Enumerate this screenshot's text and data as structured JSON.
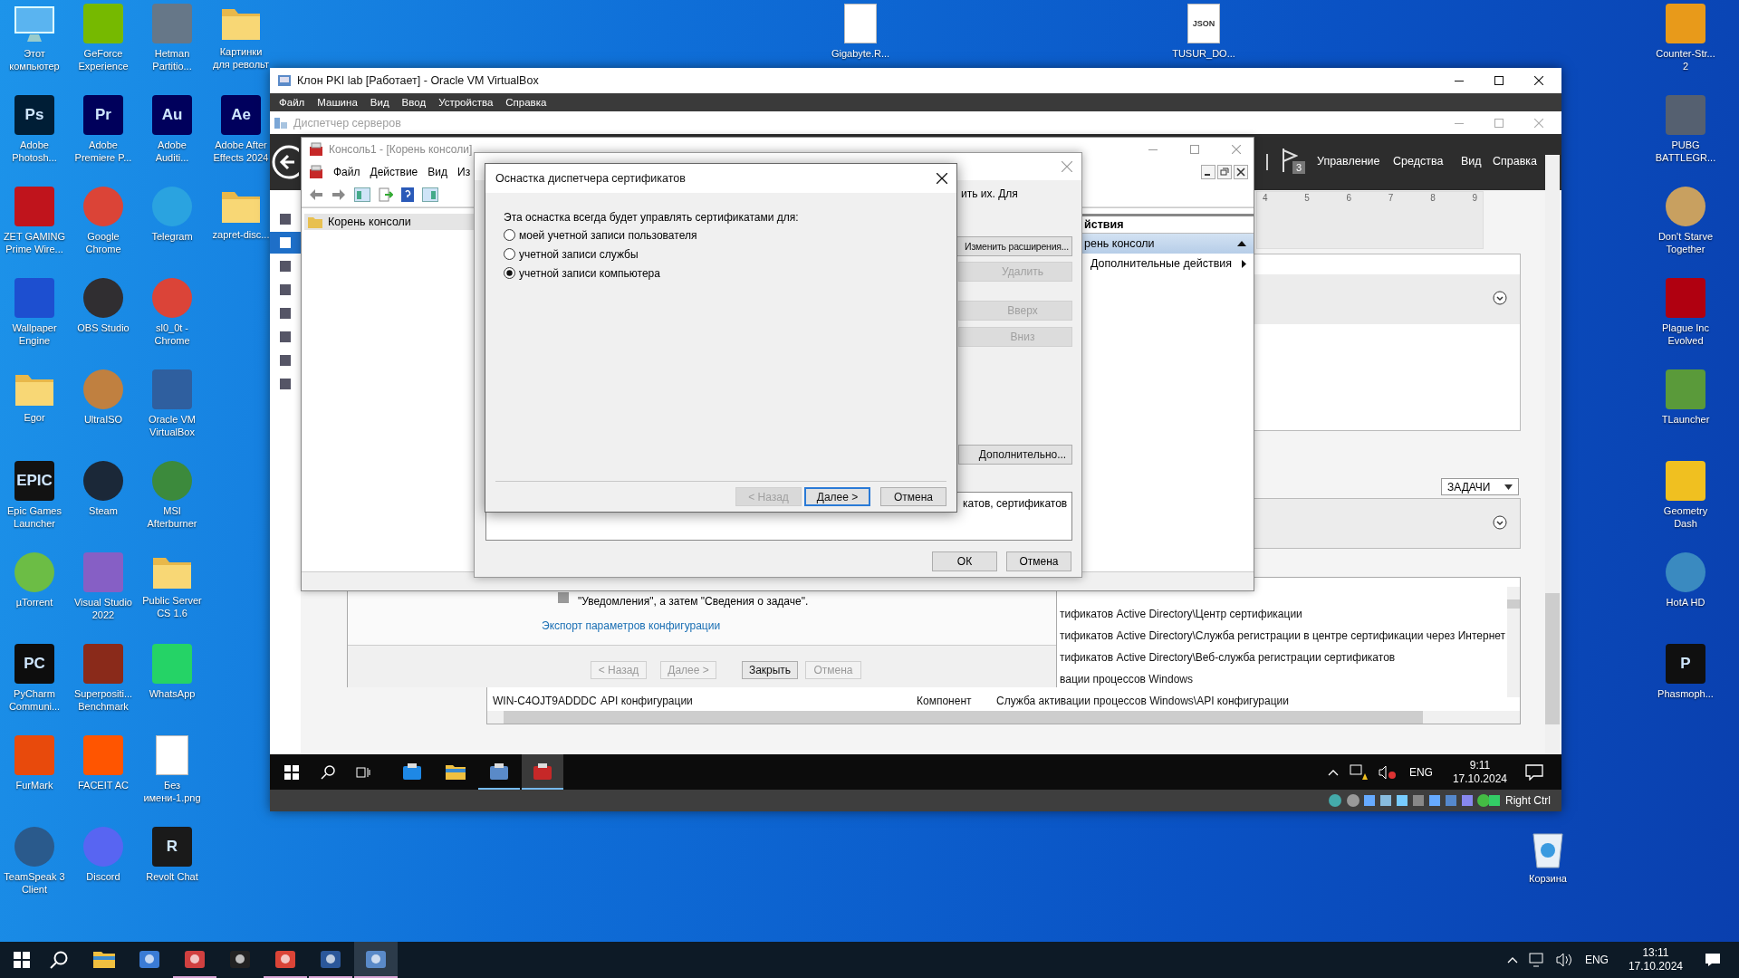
{
  "desktop": {
    "columns": [
      [
        {
          "label": "Этот\nкомпьютер",
          "kind": "computer"
        },
        {
          "label": "Adobe\nPhotosh...",
          "kind": "app",
          "color": "#001e36",
          "glyph": "Ps"
        },
        {
          "label": "ZET GAMING\nPrime Wire...",
          "kind": "app",
          "color": "#c0141c"
        },
        {
          "label": "Wallpaper\nEngine",
          "kind": "app",
          "color": "#1d4fd0"
        },
        {
          "label": "Egor",
          "kind": "folder"
        },
        {
          "label": "Epic Games\nLauncher",
          "kind": "app",
          "color": "#121212",
          "glyph": "EPIC"
        },
        {
          "label": "µTorrent",
          "kind": "round",
          "color": "#6cbd45"
        },
        {
          "label": "PyCharm\nCommuni...",
          "kind": "app",
          "color": "#0d0d0d",
          "glyph": "PC"
        },
        {
          "label": "FurMark",
          "kind": "app",
          "color": "#e84a0c"
        },
        {
          "label": "TeamSpeak 3\nClient",
          "kind": "round",
          "color": "#2a5a8c"
        }
      ],
      [
        {
          "label": "GeForce\nExperience",
          "kind": "app",
          "color": "#76b900"
        },
        {
          "label": "Adobe\nPremiere P...",
          "kind": "app",
          "color": "#00005b",
          "glyph": "Pr"
        },
        {
          "label": "Google\nChrome",
          "kind": "round",
          "color": "#db4437"
        },
        {
          "label": "OBS Studio",
          "kind": "round",
          "color": "#302e31"
        },
        {
          "label": "UltraISO",
          "kind": "round",
          "color": "#c08040"
        },
        {
          "label": "Steam",
          "kind": "round",
          "color": "#1b2838"
        },
        {
          "label": "Visual Studio\n2022",
          "kind": "app",
          "color": "#865fc5"
        },
        {
          "label": "Superpositi...\nBenchmark",
          "kind": "app",
          "color": "#8a2a1a"
        },
        {
          "label": "FACEIT AC",
          "kind": "app",
          "color": "#ff5500"
        },
        {
          "label": "Discord",
          "kind": "round",
          "color": "#5865f2"
        }
      ],
      [
        {
          "label": "Hetman\nPartitio...",
          "kind": "app",
          "color": "#667788"
        },
        {
          "label": "Adobe\nAuditi...",
          "kind": "app",
          "color": "#00005c",
          "glyph": "Au"
        },
        {
          "label": "Telegram",
          "kind": "round",
          "color": "#2aa3e0"
        },
        {
          "label": "sl0_0t -\nChrome",
          "kind": "round",
          "color": "#db4438"
        },
        {
          "label": "Oracle VM\nVirtualBox",
          "kind": "app",
          "color": "#2f5f9f"
        },
        {
          "label": "MSI\nAfterburner",
          "kind": "round",
          "color": "#3c8a3c"
        },
        {
          "label": "Public Server\nCS 1.6",
          "kind": "folder"
        },
        {
          "label": "WhatsApp",
          "kind": "app",
          "color": "#25d366"
        },
        {
          "label": "Без\nимени-1.png",
          "kind": "file"
        },
        {
          "label": "Revolt Chat",
          "kind": "app",
          "color": "#1a1a1a",
          "glyph": "R"
        }
      ],
      [
        {
          "label": "Картинки\nдля револьт",
          "kind": "folder"
        },
        {
          "label": "Adobe After\nEffects 2024",
          "kind": "app",
          "color": "#00005d",
          "glyph": "Ae"
        },
        {
          "label": "zapret-disc...",
          "kind": "folder"
        }
      ]
    ],
    "top_icons": [
      {
        "label": "Gigabyte.R...",
        "kind": "file"
      },
      {
        "label": "TUSUR_DO...",
        "kind": "file",
        "glyph": "JSON"
      }
    ],
    "right_column": [
      {
        "label": "Counter-Str...\n2",
        "kind": "app",
        "color": "#e89a1a"
      },
      {
        "label": "PUBG\nBATTLEGR...",
        "kind": "app",
        "color": "#556070"
      },
      {
        "label": "Don't Starve\nTogether",
        "kind": "round",
        "color": "#c8a060"
      },
      {
        "label": "Plague Inc\nEvolved",
        "kind": "app",
        "color": "#b00010"
      },
      {
        "label": "TLauncher",
        "kind": "app",
        "color": "#5a9a3a"
      },
      {
        "label": "Geometry\nDash",
        "kind": "app",
        "color": "#f0c020"
      },
      {
        "label": "HotA HD",
        "kind": "round",
        "color": "#3a8ac0"
      },
      {
        "label": "Phasmoph...",
        "kind": "app",
        "color": "#101010",
        "glyph": "P"
      }
    ],
    "recycle_bin": {
      "label": "Корзина",
      "kind": "bin"
    }
  },
  "vbox": {
    "title": "Клон PKI lab [Работает] - Oracle VM VirtualBox",
    "menu": [
      "Файл",
      "Машина",
      "Вид",
      "Ввод",
      "Устройства",
      "Справка"
    ],
    "server_manager": {
      "title": "Диспетчер серверов",
      "menu": [
        "Управление",
        "Средства",
        "Вид",
        "Справка"
      ],
      "notification_count": "3",
      "tile_numbers": [
        "4",
        "5",
        "6",
        "7",
        "8",
        "9"
      ],
      "tasks_button": "ЗАДАЧИ",
      "nav": [
        {
          "selected": false
        },
        {
          "selected": true
        },
        {
          "selected": false
        },
        {
          "selected": false
        },
        {
          "selected": false
        },
        {
          "selected": false
        },
        {
          "selected": false
        },
        {
          "selected": false
        }
      ]
    },
    "wizard": {
      "text": "\"Уведомления\", а затем \"Сведения о задаче\".",
      "link": "Экспорт параметров конфигурации",
      "buttons": [
        {
          "label": "< Назад",
          "disabled": true
        },
        {
          "label": "Далее >",
          "disabled": true
        },
        {
          "label": "Закрыть",
          "disabled": false
        },
        {
          "label": "Отмена",
          "disabled": true
        }
      ]
    },
    "table": {
      "rows": [
        {
          "column_4": "тификатов Active Directory\\Центр сертификации"
        },
        {
          "column_4": "тификатов Active Directory\\Служба регистрации в центре сертификации через Интернет"
        },
        {
          "column_4": "тификатов Active Directory\\Веб-служба регистрации сертификатов"
        },
        {
          "column_4": "вации процессов Windows"
        },
        {
          "column_1": "WIN-C4OJT9ADDDC",
          "column_2": "API конфигурации",
          "column_3": "Компонент",
          "column_4": "Служба активации процессов Windows\\API конфигурации"
        }
      ]
    },
    "mmc": {
      "title": "Консоль1 - [Корень консоли]",
      "menu": [
        "Файл",
        "Действие",
        "Вид",
        "Из"
      ],
      "tree": [
        {
          "label": "Корень консоли",
          "selected": true
        }
      ],
      "actions_header": "йствия",
      "actions": [
        {
          "label": "рень консоли",
          "selected": true,
          "kind": "group"
        },
        {
          "label": "Дополнительные действия",
          "selected": false,
          "kind": "submenu"
        }
      ]
    },
    "snapins": {
      "intro_fragment": "ить их. Для",
      "buttons": [
        {
          "label": "Изменить расширения...",
          "disabled": false
        },
        {
          "label": "Удалить",
          "disabled": true
        },
        {
          "label": "Вверх",
          "disabled": true
        },
        {
          "label": "Вниз",
          "disabled": true
        },
        {
          "label": "Дополнительно...",
          "disabled": false
        }
      ],
      "description_fragment": "катов, сертификатов",
      "ok": "ОК",
      "cancel": "Отмена"
    },
    "cert_dialog": {
      "title": "Оснастка диспетчера сертификатов",
      "prompt": "Эта оснастка всегда будет управлять сертификатами для:",
      "options": [
        {
          "label": "моей учетной записи пользователя",
          "selected": false
        },
        {
          "label": "учетной записи службы",
          "selected": false
        },
        {
          "label": "учетной записи компьютера",
          "selected": true
        }
      ],
      "buttons": [
        {
          "label": "< Назад",
          "disabled": true,
          "default": false
        },
        {
          "label": "Далее >",
          "disabled": false,
          "default": true
        },
        {
          "label": "Отмена",
          "disabled": false,
          "default": false
        }
      ]
    },
    "guest_taskbar": {
      "apps": [
        {
          "kind": "browser",
          "running": false,
          "selected": false
        },
        {
          "kind": "explorer",
          "running": false,
          "selected": false
        },
        {
          "kind": "server",
          "running": true,
          "selected": false
        },
        {
          "kind": "toolbox",
          "running": true,
          "selected": true
        }
      ],
      "language": "ENG",
      "time": "9:11",
      "date": "17.10.2024"
    },
    "status_bar": {
      "host_key": "Right Ctrl"
    }
  },
  "taskbar": {
    "apps": [
      {
        "kind": "explorer",
        "running": false,
        "selected": false
      },
      {
        "kind": "panel",
        "running": false,
        "selected": false
      },
      {
        "kind": "disk",
        "running": true,
        "selected": false
      },
      {
        "kind": "music",
        "running": false,
        "selected": false
      },
      {
        "kind": "chrome",
        "running": true,
        "selected": false
      },
      {
        "kind": "word",
        "running": true,
        "selected": false
      },
      {
        "kind": "server",
        "running": true,
        "selected": true
      }
    ],
    "language": "ENG",
    "time": "13:11",
    "date": "17.10.2024"
  }
}
